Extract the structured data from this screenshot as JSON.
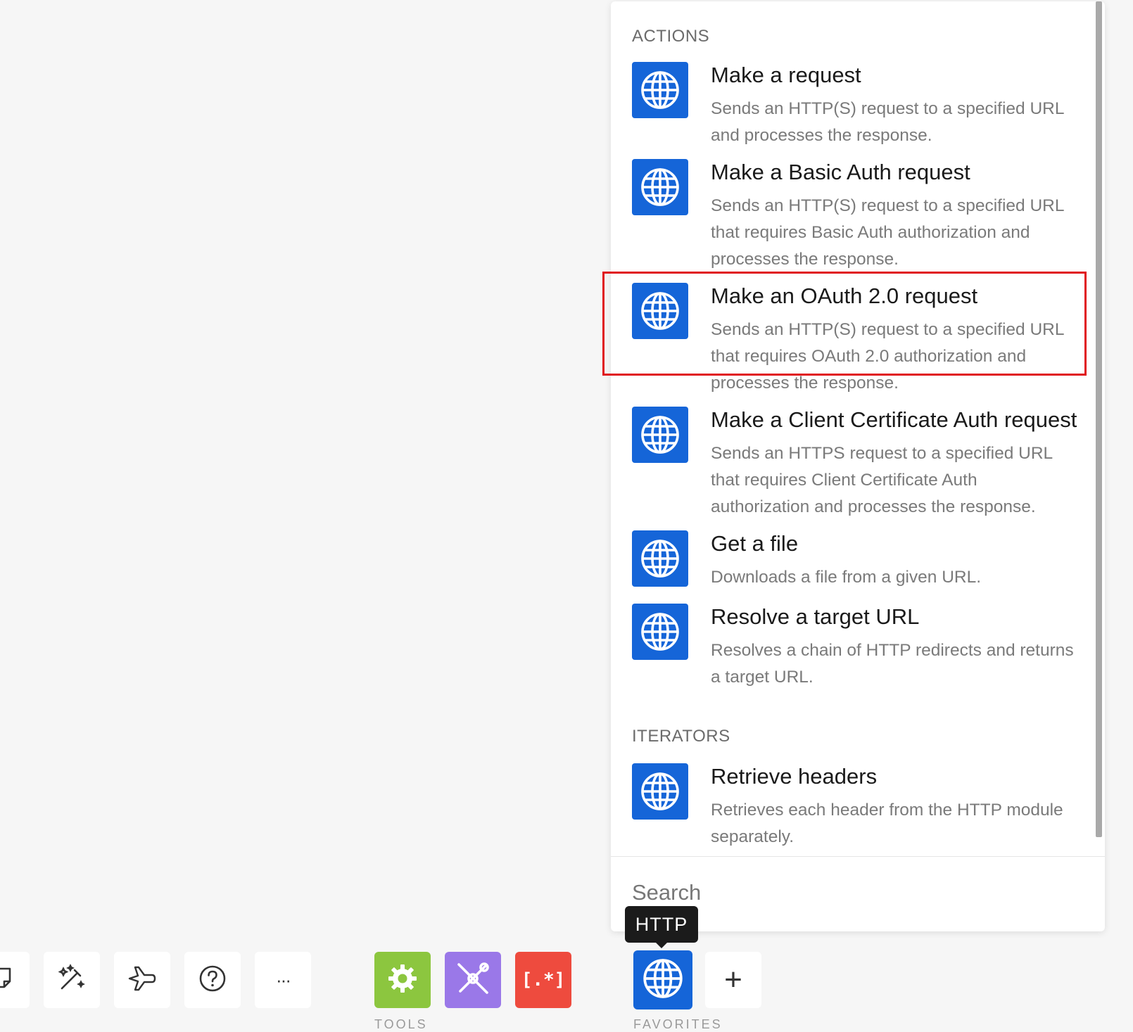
{
  "panel": {
    "sections": [
      {
        "label": "ACTIONS",
        "items": [
          {
            "title": "Make a request",
            "description": "Sends an HTTP(S) request to a specified URL and processes the response.",
            "icon": "globe-icon"
          },
          {
            "title": "Make a Basic Auth request",
            "description": "Sends an HTTP(S) request to a specified URL that requires Basic Auth authorization and processes the response.",
            "icon": "globe-icon"
          },
          {
            "title": "Make an OAuth 2.0 request",
            "description": "Sends an HTTP(S) request to a specified URL that requires OAuth 2.0 authorization and processes the response.",
            "icon": "globe-icon"
          },
          {
            "title": "Make a Client Certificate Auth request",
            "description": "Sends an HTTPS request to a specified URL that requires Client Certificate Auth authorization and processes the response.",
            "icon": "globe-icon"
          },
          {
            "title": "Get a file",
            "description": "Downloads a file from a given URL.",
            "icon": "globe-icon"
          },
          {
            "title": "Resolve a target URL",
            "description": "Resolves a chain of HTTP redirects and returns a target URL.",
            "icon": "globe-icon"
          }
        ]
      },
      {
        "label": "ITERATORS",
        "items": [
          {
            "title": "Retrieve headers",
            "description": "Retrieves each header from the HTTP module separately.",
            "icon": "globe-icon"
          }
        ]
      }
    ],
    "search": {
      "placeholder": "Search"
    }
  },
  "tooltip": {
    "text": "HTTP"
  },
  "toolbar": {
    "buttons": [
      {
        "icon": "note-icon"
      },
      {
        "icon": "magic-wand-icon"
      },
      {
        "icon": "airplane-icon"
      },
      {
        "icon": "help-icon"
      },
      {
        "icon": "more-icon",
        "glyph": "···"
      },
      {
        "icon": "gear-icon",
        "color": "#8cc63f"
      },
      {
        "icon": "tools-icon",
        "color": "#9a78e8"
      },
      {
        "icon": "text-parser-icon",
        "color": "#ee4b3e",
        "glyph": "[.*]"
      },
      {
        "icon": "globe-icon",
        "color": "#1565d8"
      },
      {
        "icon": "plus-icon",
        "glyph": "+"
      }
    ],
    "group_labels": [
      "TOOLS",
      "FAVORITES"
    ]
  },
  "colors": {
    "accent": "#1565d8",
    "highlight": "#e0141b",
    "tools_green": "#8cc63f",
    "tools_purple": "#9a78e8",
    "tools_red": "#ee4b3e"
  }
}
